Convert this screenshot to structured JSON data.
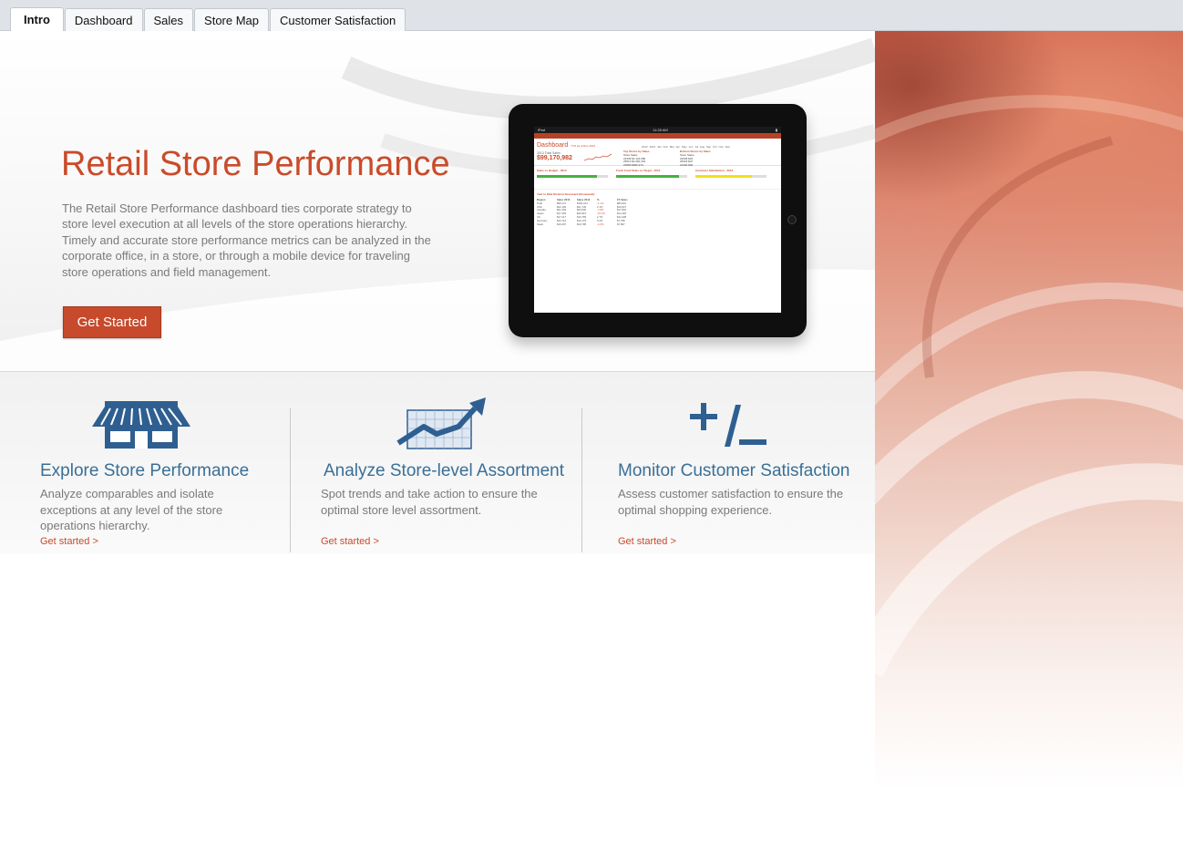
{
  "tabs": [
    {
      "label": "Intro",
      "active": true
    },
    {
      "label": "Dashboard",
      "active": false
    },
    {
      "label": "Sales",
      "active": false
    },
    {
      "label": "Store Map",
      "active": false
    },
    {
      "label": "Customer Satisfaction",
      "active": false
    }
  ],
  "hero": {
    "title": "Retail Store Performance",
    "description": "The Retail Store Performance dashboard ties corporate strategy to store level execution at all levels of the store operations hierarchy. Timely and accurate store performance metrics can be analyzed in the corporate office, in a store, or through a mobile device for traveling store operations and field management.",
    "cta_label": "Get Started"
  },
  "ipad": {
    "status_left": "iPad",
    "status_time": "11:28 AM",
    "dash_title": "Dashboard",
    "dash_sub": "YTD as of Dec 2013",
    "months": "2012 2013 Jan Feb Mar Apr May Jun Jul Aug Sep Oct Nov Dec",
    "kpi_label": "2013 Total Sales",
    "kpi_value": "$99,170,982",
    "top_header": "Top Stores by Sales",
    "top_rows": [
      "Store Sales",
      "24339 $1,124,680",
      "25512 $1,081,304",
      "23559 $966,374"
    ],
    "bottom_header": "Bottom Stores by Sales",
    "bottom_rows": [
      "Store Sales",
      "24028 $24",
      "25318 $37",
      "24330 $40"
    ],
    "bars": [
      {
        "title": "Sales vs Budget - 2013",
        "fill": 0.85,
        "color": "#46b23c"
      },
      {
        "title": "Fresh Food Sales vs Target - 2013",
        "fill": 0.88,
        "color": "#46b23c"
      },
      {
        "title": "Customer Satisfaction - 2013",
        "fill": 0.8,
        "color": "#f2e11c"
      }
    ],
    "table_title": "Year to Date Division Scorecard (thousands)",
    "table_rows": [
      [
        "Region",
        "Sales 2013",
        "Sales 2012",
        "%",
        "FF Sales"
      ],
      [
        "Total",
        "$99,171",
        "$100,314",
        "-1.1%",
        "$83,001"
      ],
      [
        "USA",
        "$22,195",
        "$21,745",
        "2.1%",
        "$19,937"
      ],
      [
        "Canada",
        "$21,209",
        "$23,000",
        "-7.8%",
        "$17,822"
      ],
      [
        "Japan",
        "$17,493",
        "$20,913",
        "-16.4%",
        "$14,118"
      ],
      [
        "UK",
        "$17,217",
        "$16,765",
        "2.7%",
        "$12,228"
      ],
      [
        "Germany",
        "$10,712",
        "$10,179",
        "5.2%",
        "$7,788"
      ],
      [
        "Spain",
        "$10,297",
        "$10,795",
        "-4.6%",
        "$7,897"
      ]
    ]
  },
  "features": [
    {
      "title": "Explore Store Performance",
      "desc": "Analyze comparables and isolate exceptions at any level of the store operations hierarchy.",
      "link": "Get started >",
      "icon": "storefront-icon"
    },
    {
      "title": "Analyze Store-level Assortment",
      "desc": "Spot trends and take action to ensure the optimal store level assortment.",
      "link": "Get started >",
      "icon": "trend-chart-icon"
    },
    {
      "title": "Monitor Customer Satisfaction",
      "desc": "Assess customer satisfaction to ensure the optimal shopping experience.",
      "link": "Get started >",
      "icon": "plus-minus-icon"
    }
  ],
  "colors": {
    "accent": "#c94b2a",
    "feature_blue": "#3a6f96",
    "icon_blue": "#2f5f91"
  }
}
